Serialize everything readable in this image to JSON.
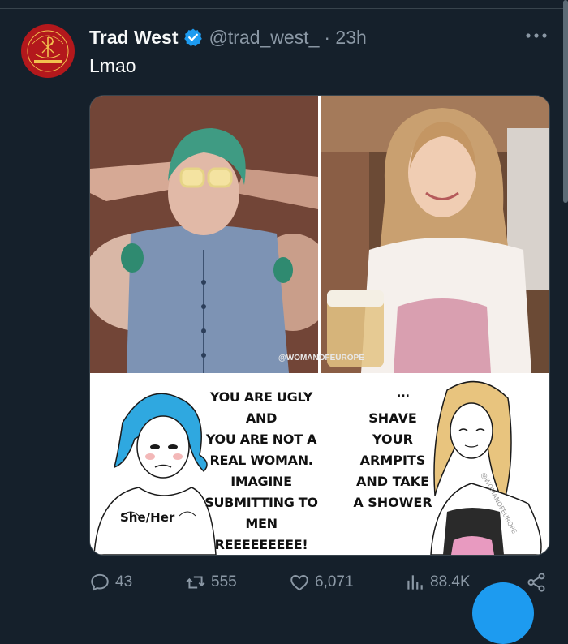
{
  "tweet": {
    "author_name": "Trad West",
    "handle": "@trad_west_",
    "time": "· 23h",
    "text": "Lmao",
    "avatar_text": "TRAD WEST",
    "avatar_motto": "IN HOC SIGNO VINCES"
  },
  "media": {
    "watermark": "@WOMANOFEUROPE",
    "meme_left_lines": [
      "YOU ARE UGLY AND",
      "YOU ARE NOT A",
      "REAL WOMAN.",
      "IMAGINE",
      "SUBMITTING TO",
      "MEN",
      "REEEEEEEEE!"
    ],
    "meme_ellipsis": "...",
    "meme_right_lines": [
      "SHAVE",
      "YOUR",
      "ARMPITS",
      "AND TAKE",
      "A SHOWER"
    ],
    "pronoun_label": "She/Her",
    "meme_watermark": "@WOMANOFEUROPE"
  },
  "actions": {
    "replies": "43",
    "reposts": "555",
    "likes": "6,071",
    "views": "88.4K"
  },
  "icons": [
    "verified-icon",
    "more-icon",
    "reply-icon",
    "repost-icon",
    "like-icon",
    "views-icon",
    "share-icon"
  ],
  "colors": {
    "background": "#15202b",
    "text": "#f7f9f9",
    "muted": "#8b98a5",
    "accent": "#1d9bf0",
    "avatar": "#b3181c"
  }
}
